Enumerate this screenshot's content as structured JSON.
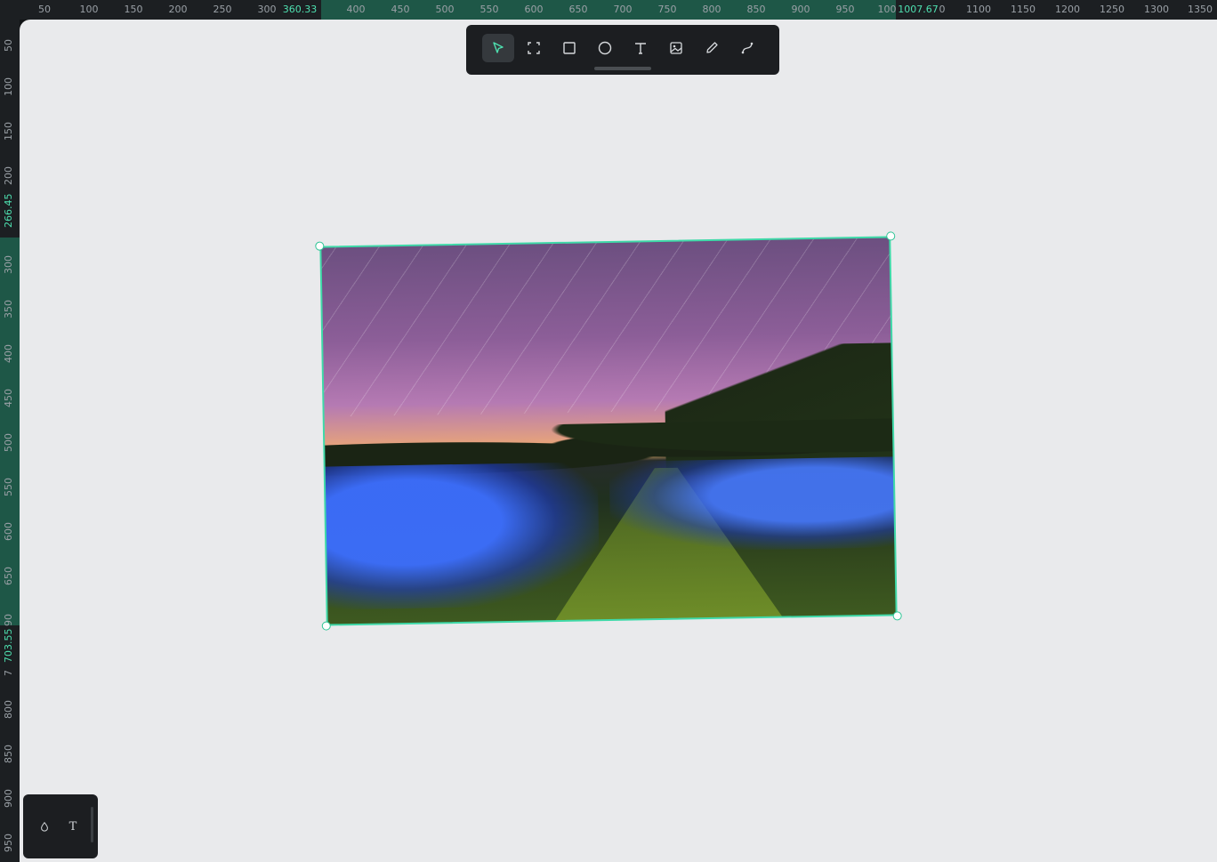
{
  "ruler_top": {
    "ticks": [
      "50",
      "100",
      "150",
      "200",
      "250",
      "300",
      "400",
      "450",
      "500",
      "550",
      "600",
      "650",
      "700",
      "750",
      "800",
      "850",
      "900",
      "950",
      "100",
      "1100",
      "1150",
      "1200",
      "1250",
      "1300",
      "1350"
    ],
    "selection_start": "360.33",
    "selection_end": "1007.67",
    "selection_end_suffix": "0"
  },
  "ruler_left": {
    "ticks": [
      "50",
      "100",
      "150",
      "200",
      "300",
      "350",
      "400",
      "450",
      "500",
      "550",
      "600",
      "650",
      "800",
      "850",
      "900",
      "950"
    ],
    "partial_ticks": [
      "90",
      "7"
    ],
    "selection_start": "266.45",
    "selection_end": "703.55"
  },
  "toolbar": {
    "tools": [
      {
        "name": "select",
        "icon": "cursor-arrow-icon",
        "active": true
      },
      {
        "name": "frame",
        "icon": "frame-corners-icon",
        "active": false
      },
      {
        "name": "rectangle",
        "icon": "square-icon",
        "active": false
      },
      {
        "name": "ellipse",
        "icon": "circle-icon",
        "active": false
      },
      {
        "name": "text",
        "icon": "text-icon",
        "active": false
      },
      {
        "name": "image",
        "icon": "image-icon",
        "active": false
      },
      {
        "name": "pen",
        "icon": "pencil-icon",
        "active": false
      },
      {
        "name": "path",
        "icon": "bezier-curve-icon",
        "active": false
      }
    ]
  },
  "canvas": {
    "background": "#e9eaec",
    "selection_color": "#3fd9a8",
    "selected_object": "image"
  },
  "bottom_panel": {
    "buttons": [
      {
        "icon": "droplet-icon"
      },
      {
        "icon": "text-icon",
        "label": "T"
      }
    ]
  }
}
